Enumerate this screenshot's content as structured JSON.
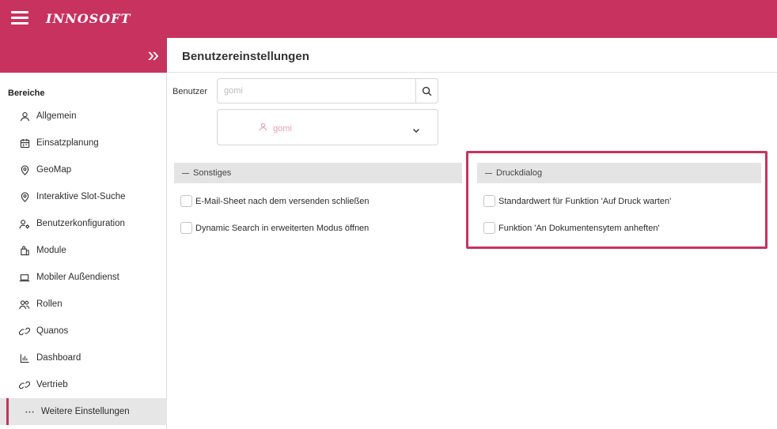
{
  "app": {
    "logo": "INNOSOFT"
  },
  "sidebar": {
    "section_title": "Bereiche",
    "items": [
      {
        "label": "Allgemein",
        "icon": "person-icon"
      },
      {
        "label": "Einsatzplanung",
        "icon": "calendar-icon"
      },
      {
        "label": "GeoMap",
        "icon": "location-pin-icon"
      },
      {
        "label": "Interaktive Slot-Suche",
        "icon": "location-pin-icon"
      },
      {
        "label": "Benutzerkonfiguration",
        "icon": "user-settings-icon"
      },
      {
        "label": "Module",
        "icon": "module-icon"
      },
      {
        "label": "Mobiler Außendienst",
        "icon": "laptop-icon"
      },
      {
        "label": "Rollen",
        "icon": "users-icon"
      },
      {
        "label": "Quanos",
        "icon": "link-icon"
      },
      {
        "label": "Dashboard",
        "icon": "bar-chart-icon"
      },
      {
        "label": "Vertrieb",
        "icon": "link-icon"
      },
      {
        "label": "Weitere Einstellungen",
        "icon": "more-dots-icon",
        "active": true
      }
    ]
  },
  "header": {
    "title": "Benutzereinstellungen"
  },
  "user_filter": {
    "label": "Benutzer",
    "search_value": "gomi",
    "selected_user": "gomi"
  },
  "panels": {
    "sonstiges": {
      "title": "Sonstiges",
      "options": [
        {
          "label": "E-Mail-Sheet nach dem versenden schließen",
          "checked": false
        },
        {
          "label": "Dynamic Search in erweiterten Modus öffnen",
          "checked": false
        }
      ]
    },
    "druckdialog": {
      "title": "Druckdialog",
      "options": [
        {
          "label": "Standardwert für Funktion 'Auf Druck warten'",
          "checked": false
        },
        {
          "label": "Funktion 'An Dokumentensytem anheften'",
          "checked": false
        }
      ]
    }
  },
  "colors": {
    "brand": "#c8325f",
    "panel_header": "#e4e4e4",
    "active_item": "#e6e6e6"
  }
}
